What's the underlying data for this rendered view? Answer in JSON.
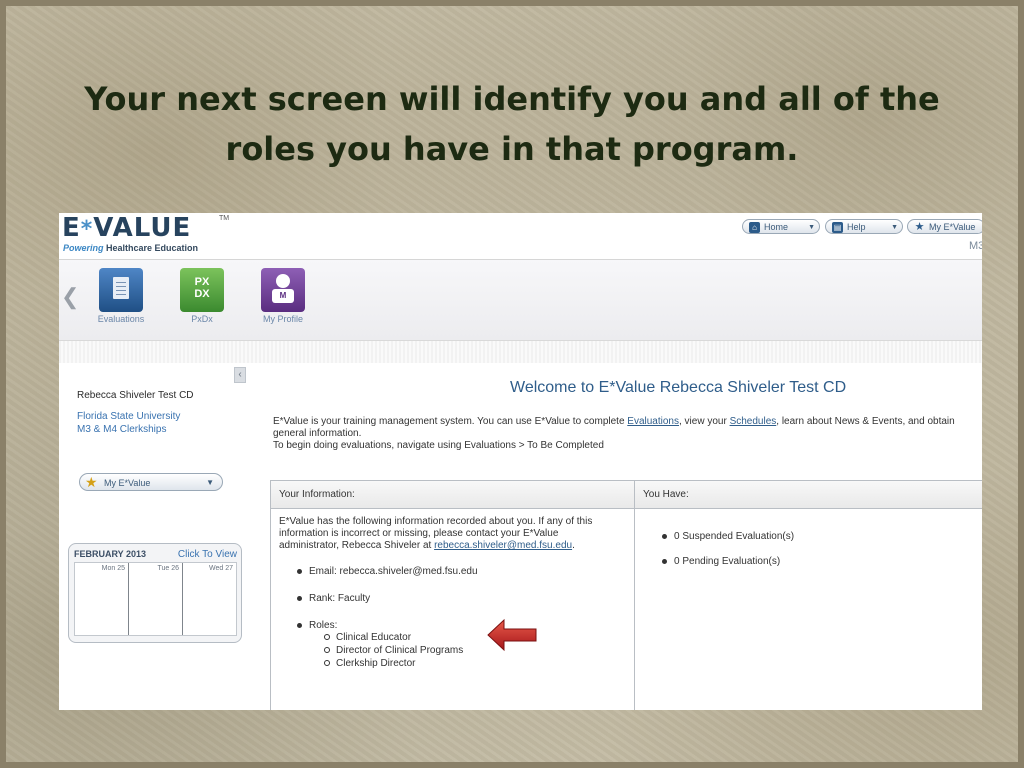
{
  "slide": {
    "title_line1": "Your next screen will identify you and all of the",
    "title_line2": "roles you have in that program."
  },
  "header": {
    "logo_text": "E",
    "logo_star": "*",
    "logo_text2": "VALUE",
    "logo_tm": "TM",
    "tagline_powering": "Powering",
    "tagline_rest": " Healthcare Education",
    "nav": [
      {
        "label": "Home",
        "icon": "home-icon"
      },
      {
        "label": "Help",
        "icon": "help-icon"
      },
      {
        "label": "My E*Value",
        "icon": "star-icon"
      }
    ],
    "m3": "M3"
  },
  "apps": [
    {
      "label": "Evaluations",
      "color": "#2c5f95"
    },
    {
      "label": "PxDx",
      "color": "#4a9a3c",
      "tile_text": "PX DX"
    },
    {
      "label": "My Profile",
      "color": "#6b3e8e"
    }
  ],
  "sidebar": {
    "user_name": "Rebecca Shiveler Test CD",
    "org_line1": "Florida State University",
    "org_line2": "M3 & M4 Clerkships",
    "my_evalue": "My E*Value",
    "calendar": {
      "month": "FEBRUARY 2013",
      "link": "Click To View",
      "days": [
        "Mon 25",
        "Tue 26",
        "Wed 27"
      ]
    }
  },
  "main": {
    "welcome": "Welcome to E*Value Rebecca Shiveler Test CD",
    "intro_pre": "E*Value is your training management system. You can use E*Value to complete ",
    "intro_link1": "Evaluations",
    "intro_mid": ", view your ",
    "intro_link2": "Schedules",
    "intro_post": ", learn about News & Events, and obtain general information.",
    "intro_line2": "To begin doing evaluations, navigate using Evaluations > To Be Completed",
    "your_info": {
      "title": "Your Information:",
      "text": "E*Value has the following information recorded about you. If any of this information is incorrect or missing, please contact your E*Value administrator, Rebecca Shiveler at ",
      "email_link": "rebecca.shiveler@med.fsu.edu",
      "text_end": ".",
      "email": "Email: rebecca.shiveler@med.fsu.edu",
      "rank": "Rank: Faculty",
      "roles_label": "Roles:",
      "roles": [
        "Clinical Educator",
        "Director of Clinical Programs",
        "Clerkship Director"
      ]
    },
    "you_have": {
      "title": "You Have:",
      "items": [
        "0 Suspended Evaluation(s)",
        "0 Pending Evaluation(s)"
      ]
    }
  }
}
